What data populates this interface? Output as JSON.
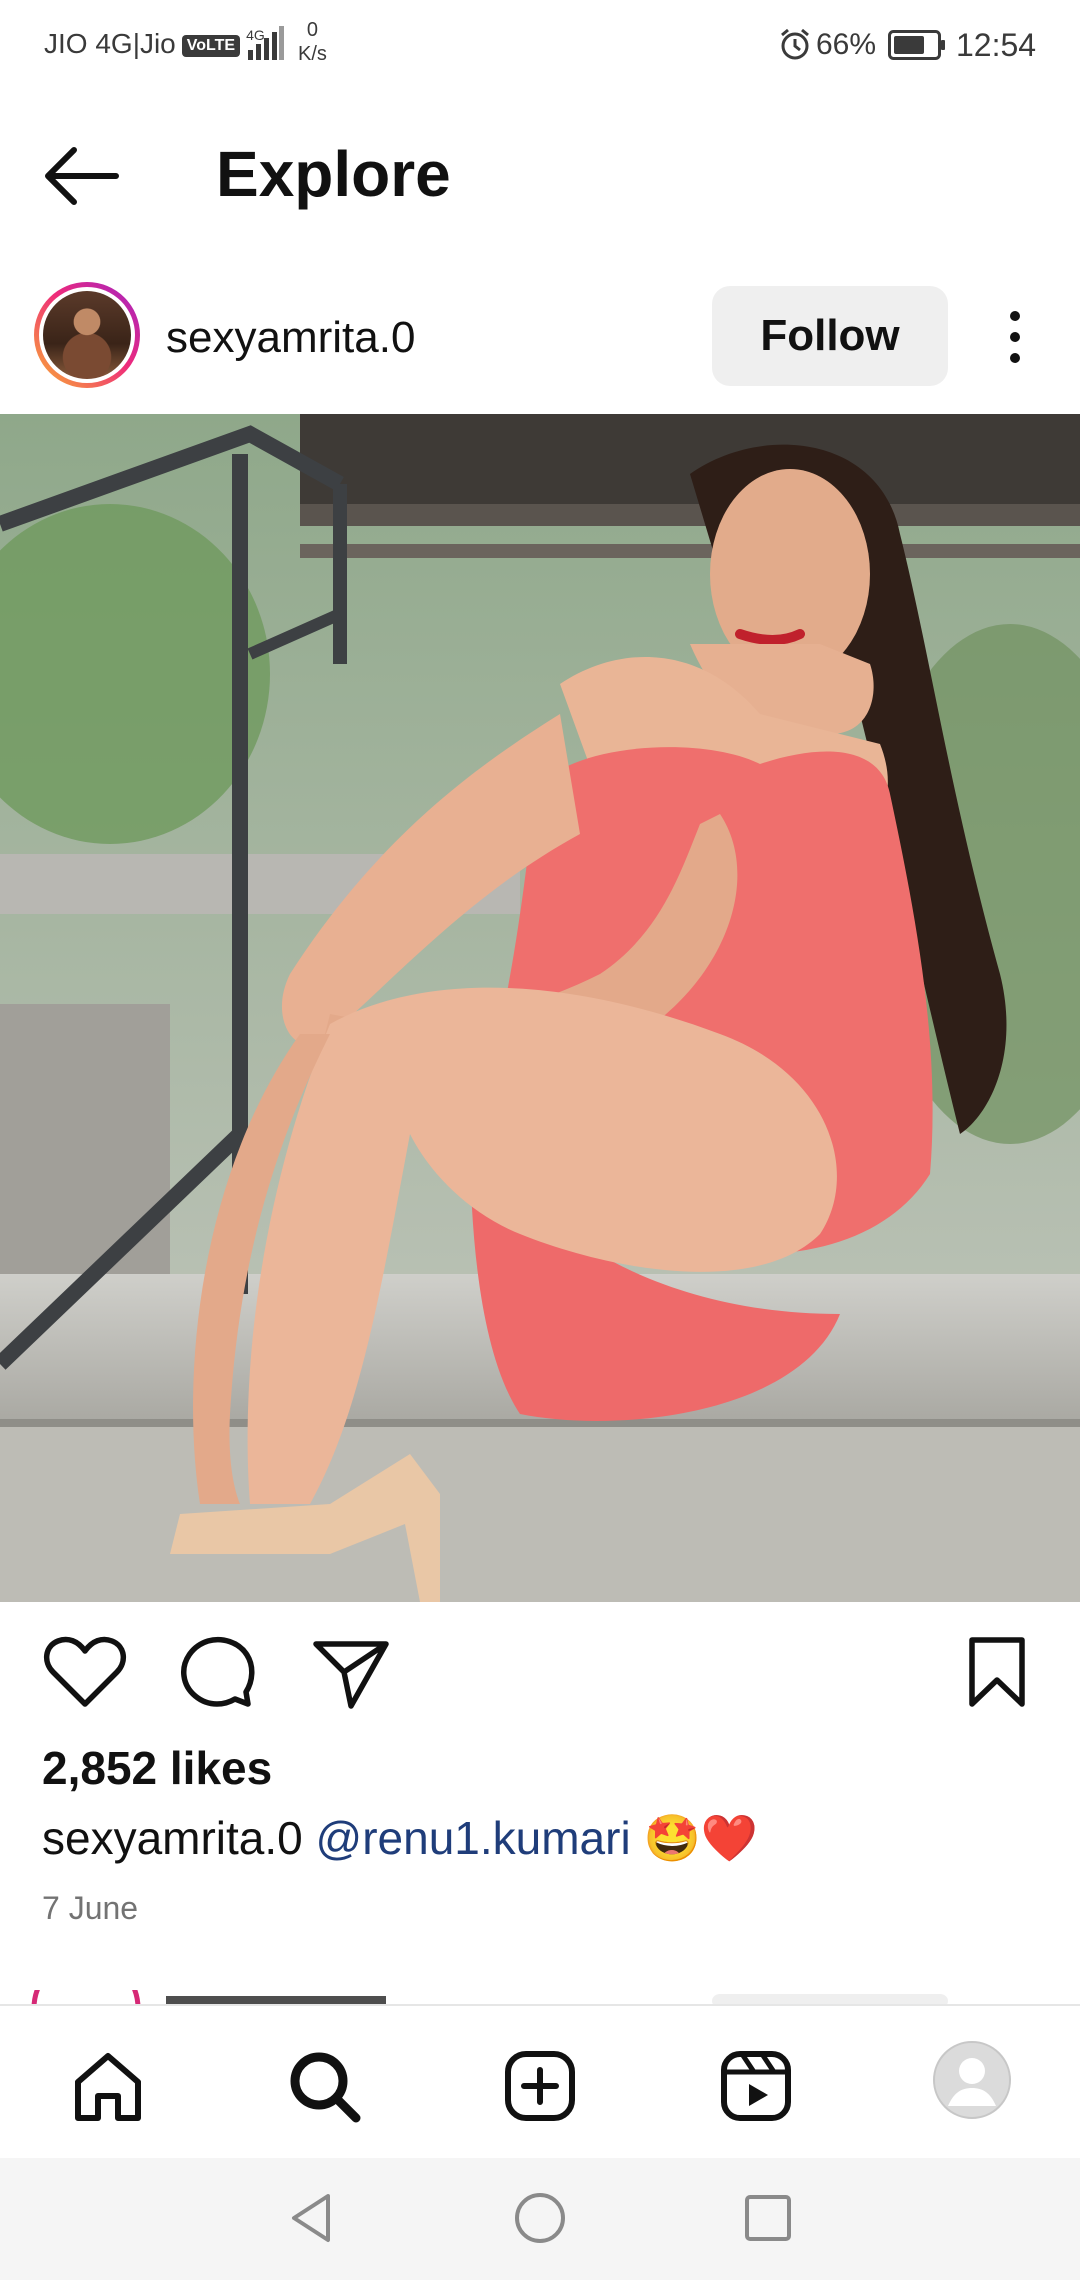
{
  "status_bar": {
    "carrier": "JIO 4G|Jio",
    "volte": "VoLTE",
    "network_type": "4G",
    "net_speed_value": "0",
    "net_speed_unit": "K/s",
    "battery_percent": "66%",
    "time": "12:54"
  },
  "header": {
    "title": "Explore",
    "back_icon": "arrow-left-icon"
  },
  "post": {
    "username": "sexyamrita.0",
    "follow_label": "Follow",
    "likes": "2,852 likes",
    "caption_user": "sexyamrita.0",
    "caption_mention": "@renu1.kumari",
    "caption_emoji": "🤩❤️",
    "date": "7 June",
    "actions": [
      "heart-icon",
      "comment-icon",
      "send-icon",
      "bookmark-icon"
    ]
  },
  "bottom_nav": {
    "items": [
      "home-icon",
      "search-icon",
      "create-icon",
      "reels-icon",
      "profile-icon"
    ],
    "active": "search-icon"
  },
  "system_nav": [
    "back-triangle-icon",
    "home-circle-icon",
    "recents-square-icon"
  ],
  "colors": {
    "mention": "#1f3d7a",
    "follow_bg": "#efefef",
    "story_ring_start": "#f9b132",
    "story_ring_end": "#a023c6",
    "date": "#737373"
  }
}
